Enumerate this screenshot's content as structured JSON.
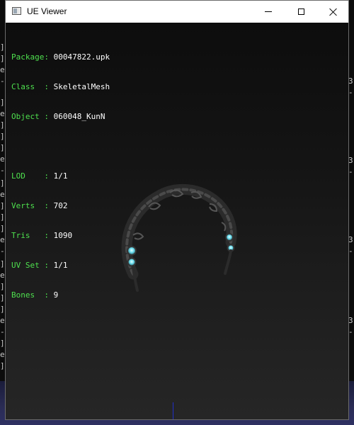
{
  "window": {
    "title": "UE Viewer"
  },
  "info": {
    "package_label": "Package:",
    "package": "00047822.upk",
    "class_label": "Class  :",
    "class": "SkeletalMesh",
    "object_label": "Object :",
    "object": "060048_KunN",
    "lod_label": "LOD    :",
    "lod": "1/1",
    "verts_label": "Verts  :",
    "verts": "702",
    "tris_label": "Tris   :",
    "tris": "1090",
    "uvset_label": "UV Set :",
    "uvset": "1/1",
    "bones_label": "Bones  :",
    "bones": "9"
  },
  "colors": {
    "label_green": "#4ee04e",
    "value_white": "#ffffff",
    "titlebar": "#ffffff",
    "gem_cyan": "#6fe0f0"
  },
  "icons": {
    "app": "app-window-icon",
    "minimize": "minimize-icon",
    "maximize": "maximize-icon",
    "close": "close-icon"
  }
}
